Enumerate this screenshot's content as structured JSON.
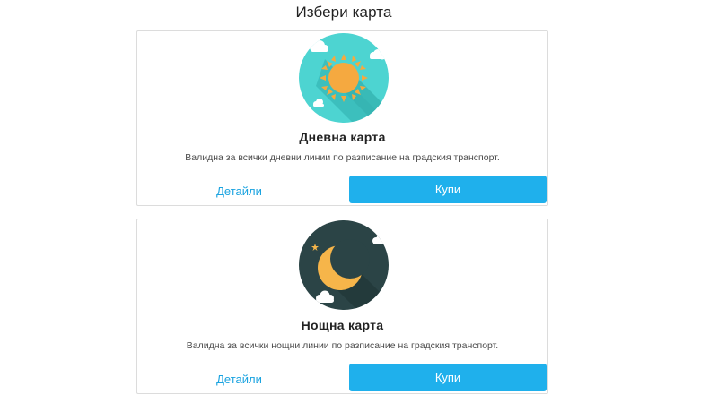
{
  "page": {
    "title": "Избери карта"
  },
  "cards": [
    {
      "title": "Дневна карта",
      "description": "Валидна за всички дневни линии по разписание на градския транспорт.",
      "details_label": "Детайли",
      "buy_label": "Купи",
      "icon": "sun-icon"
    },
    {
      "title": "Нощна карта",
      "description": "Валидна за всички нощни линии по разписание на градския транспорт.",
      "details_label": "Детайли",
      "buy_label": "Купи",
      "icon": "moon-icon"
    }
  ],
  "colors": {
    "accent": "#1fb0ec",
    "link": "#1aa3e0",
    "day_sky": "#4dd4d1",
    "night_sky": "#2b4446",
    "sun": "#f5a940",
    "moon": "#f6b54a"
  }
}
